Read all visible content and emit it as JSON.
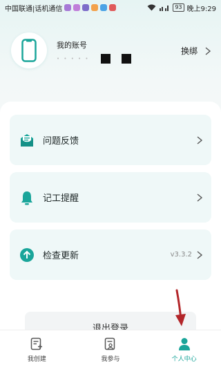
{
  "status_bar": {
    "carrier": "中国联通|话机通信",
    "battery": "93",
    "time": "晚上9:29",
    "notification_colors": [
      "#a678d6",
      "#c07ed9",
      "#7d6cc9",
      "#f3a14a",
      "#4aa3e6",
      "#e05a5a"
    ]
  },
  "account": {
    "title": "我的账号",
    "masked_dots": "• • • • •",
    "switch_label": "换绑"
  },
  "menu": [
    {
      "label": "问题反馈",
      "icon": "feedback-icon",
      "version": ""
    },
    {
      "label": "记工提醒",
      "icon": "bell-icon",
      "version": ""
    },
    {
      "label": "检查更新",
      "icon": "upload-arrow-icon",
      "version": "v3.3.2"
    }
  ],
  "logout_label": "退出登录",
  "tabs": [
    {
      "label": "我创建",
      "icon": "create-doc-icon",
      "active": false
    },
    {
      "label": "我参与",
      "icon": "join-doc-icon",
      "active": false
    },
    {
      "label": "个人中心",
      "icon": "person-icon",
      "active": true
    }
  ],
  "colors": {
    "accent": "#1aa59a",
    "card_bg": "#eff8f8",
    "annotation_arrow": "#b3262a"
  }
}
